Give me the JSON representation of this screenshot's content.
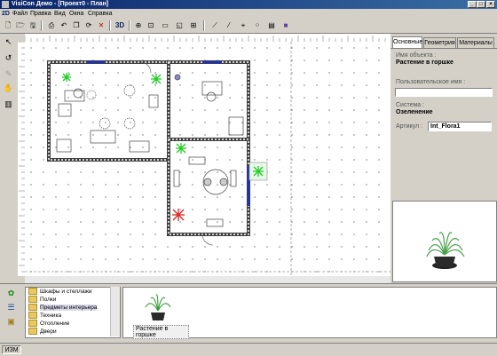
{
  "window": {
    "title": "VisiCon Демо - [Проект0 - План]"
  },
  "menu": {
    "logo": "2D",
    "items": [
      "Файл",
      "Правка",
      "Вид",
      "Окна",
      "Справка"
    ]
  },
  "toolbar": {
    "label_3d": "3D"
  },
  "properties": {
    "tabs": [
      "Основные",
      "Геометрия",
      "Материалы"
    ],
    "object_name_label": "Имя объекта :",
    "object_name_value": "Растение в горшке",
    "user_name_label": "Пользовательское имя :",
    "user_name_value": "",
    "system_label": "Система :",
    "system_value": "Озеленение",
    "article_label": "Артикул :",
    "article_value": "Int_Flora1"
  },
  "catalog": {
    "items": [
      "Шкафы и стеллажи",
      "Полки",
      "Предметы интерьера",
      "Техника",
      "Отопление",
      "Двери"
    ],
    "selected_index": 2
  },
  "objects": {
    "items": [
      {
        "label": "Растение в горшке"
      }
    ]
  },
  "status": {
    "mode": "ИЗМ"
  },
  "colors": {
    "accent": "#0a246a",
    "plant_green": "#22cc22",
    "plant_red": "#dd2222",
    "wall": "#404040"
  }
}
